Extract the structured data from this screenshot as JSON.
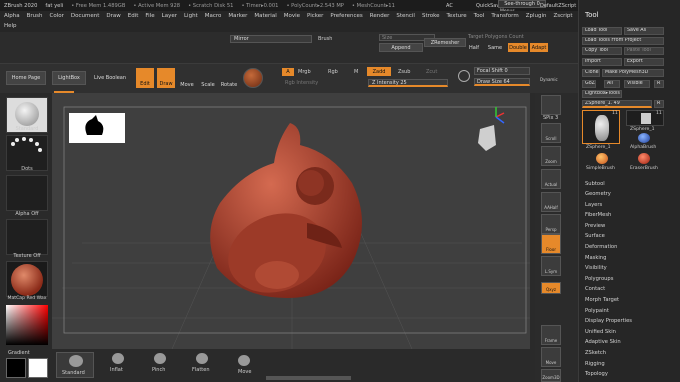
{
  "titlebar": {
    "app": "ZBrush 2020",
    "file": "fat yeli",
    "free_mem": "• Free Mem 1.489GB",
    "active_mem": "• Active Mem 928",
    "scratch": "• Scratch Disk 51",
    "timer": "• Timer▸0.001",
    "polycount": "• PolyCount▸2.543 MP",
    "meshcount": "• MeshCount▸11",
    "ac": "AC",
    "quicksave": "QuickSave",
    "see_through": "See-through 0",
    "menus_label": "Menus",
    "script": "DefaultZScript"
  },
  "menu": {
    "items": [
      "Alpha",
      "Brush",
      "Color",
      "Document",
      "Draw",
      "Edit",
      "File",
      "Layer",
      "Light",
      "Macro",
      "Marker",
      "Material",
      "Movie",
      "Picker",
      "Preferences",
      "Render",
      "Stencil",
      "Stroke",
      "Texture",
      "Tool",
      "Transform",
      "Zplugin",
      "Zscript"
    ],
    "help": "Help"
  },
  "toolbar": {
    "mirror": "Mirror",
    "brush": "Brush",
    "size_label": "Size",
    "append": "Append",
    "zremesher": "ZRemesher",
    "target_poly": "Target Polygons Count",
    "half": "Half",
    "same": "Same",
    "double": "Double",
    "adapt": "Adapt"
  },
  "toolbar2": {
    "home": "Home Page",
    "lightbox": "LightBox",
    "live_boolean": "Live Boolean",
    "edit": "Edit",
    "draw": "Draw",
    "move": "Move",
    "scale": "Scale",
    "rotate": "Rotate",
    "a": "A",
    "mrgb": "Mrgb",
    "rgb": "Rgb",
    "m": "M",
    "zadd": "Zadd",
    "zsub": "Zsub",
    "zcut": "Zcut",
    "rgb_intensity": "Rgb Intensity",
    "z_intensity": "Z Intensity 25",
    "focal_shift": "Focal Shift 0",
    "draw_size": "Draw Size 64",
    "dynamic": "Dynamic"
  },
  "left": {
    "standard": "Standard",
    "dots": "Dots",
    "alpha_off": "Alpha Off",
    "texture_off": "Texture Off",
    "matcap": "MatCap Red Wax",
    "gradient": "Gradient"
  },
  "right_shelf": {
    "spix": "SPix 3",
    "scroll": "Scroll",
    "zoom": "Zoom",
    "actual": "Actual",
    "aahalf": "AAHalf",
    "persp": "Persp",
    "floor": "Floor",
    "lsym": "L.Sym",
    "qxyz": "Qxyz",
    "frame": "Frame",
    "move": "Move",
    "zoom3d": "Zoom3D",
    "rotate": "Rotate"
  },
  "brushes": [
    "Standard",
    "Inflat",
    "Pinch",
    "Flatten",
    "Move"
  ],
  "tool_panel": {
    "title": "Tool",
    "load_tool": "Load Tool",
    "save_as": "Save As",
    "load_from_project": "Load Tools From Project",
    "copy_tool": "Copy Tool",
    "paste_tool": "Paste Tool",
    "import": "Import",
    "export": "Export",
    "clone": "Clone",
    "make_polymesh": "Make PolyMesh3D",
    "goz": "GoZ",
    "all": "All",
    "visible": "Visible",
    "r": "R",
    "lightbox_tools": "Lightbox▸Tools",
    "zsphere_label": "ZSphere_1. 49",
    "r2": "R",
    "count1": "11",
    "count2": "11",
    "thumb1": "ZSphere_1",
    "thumb2": "ZSphere_1",
    "thumb3": "AlphaBrush",
    "thumb4": "SimpleBrush",
    "thumb5": "EraserBrush",
    "items": [
      "Subtool",
      "Geometry",
      "Layers",
      "FiberMesh",
      "Preview",
      "Surface",
      "Deformation",
      "Masking",
      "Visibility",
      "Polygroups",
      "Contact",
      "Morph Target",
      "Polypaint",
      "Display Properties",
      "Unified Skin",
      "Adaptive Skin",
      "ZSketch",
      "Rigging",
      "Topology"
    ]
  },
  "colors": {
    "accent": "#e6892a",
    "model": "#a8412f"
  }
}
